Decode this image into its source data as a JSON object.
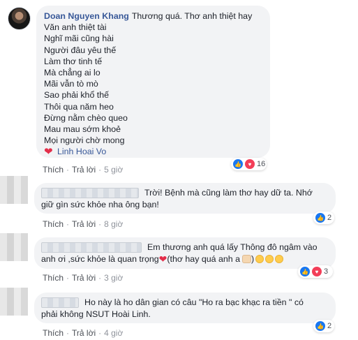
{
  "colors": {
    "author_link": "#385898",
    "bubble_bg": "#f2f3f5",
    "meta_text": "#90949c",
    "like_blue": "#1877f2",
    "love_red": "#f33e58"
  },
  "comments": [
    {
      "author": "Doan Nguyen Khang",
      "lines": [
        "Thương quá. Thơ anh thiệt hay",
        "Văn anh thiệt tài",
        "Nghĩ mãi cũng hài",
        "Người đâu yêu thế",
        "Làm thơ tinh tế",
        "Mà chẳng ai lo",
        "Mãi vẫn tò mò",
        "Sao phải khổ thế",
        "Thôi qua năm heo",
        "Đừng nằm chèo queo",
        "Mau mau sớm khoẻ",
        "Mọi người chờ mong"
      ],
      "mention": "Linh Hoai Vo",
      "actions": {
        "like": "Thích",
        "reply": "Trả lời",
        "time": "5 giờ"
      },
      "reactions": {
        "icons": [
          "like-icon",
          "love-icon"
        ],
        "count": "16"
      }
    },
    {
      "text_line_1": "Trời! Bệnh mà cũng làm thơ hay dữ ta. Nhớ",
      "text_line_2": "giữ gìn sức khỏe nha ông bạn!",
      "actions": {
        "like": "Thích",
        "reply": "Trả lời",
        "time": "8 giờ"
      },
      "reactions": {
        "icons": [
          "like-icon"
        ],
        "count": "2"
      }
    },
    {
      "text_line_1": "Em thương anh quá lấy Thông đô ngâm vào",
      "text_line_2a": "anh ơi ,sức khỏe là quan trọng",
      "text_line_2b": "(thơ hay quá anh a",
      "actions": {
        "like": "Thích",
        "reply": "Trả lời",
        "time": "3 giờ"
      },
      "reactions": {
        "icons": [
          "like-icon",
          "love-icon"
        ],
        "count": "3"
      }
    },
    {
      "text_line_1": "Ho này là ho dân gian có câu \"Ho ra bạc khạc ra tiền \" có",
      "text_line_2": "phải không NSUT Hoài Linh.",
      "actions": {
        "like": "Thích",
        "reply": "Trả lời",
        "time": "4 giờ"
      },
      "reactions": {
        "icons": [
          "like-icon"
        ],
        "count": "2"
      }
    }
  ]
}
